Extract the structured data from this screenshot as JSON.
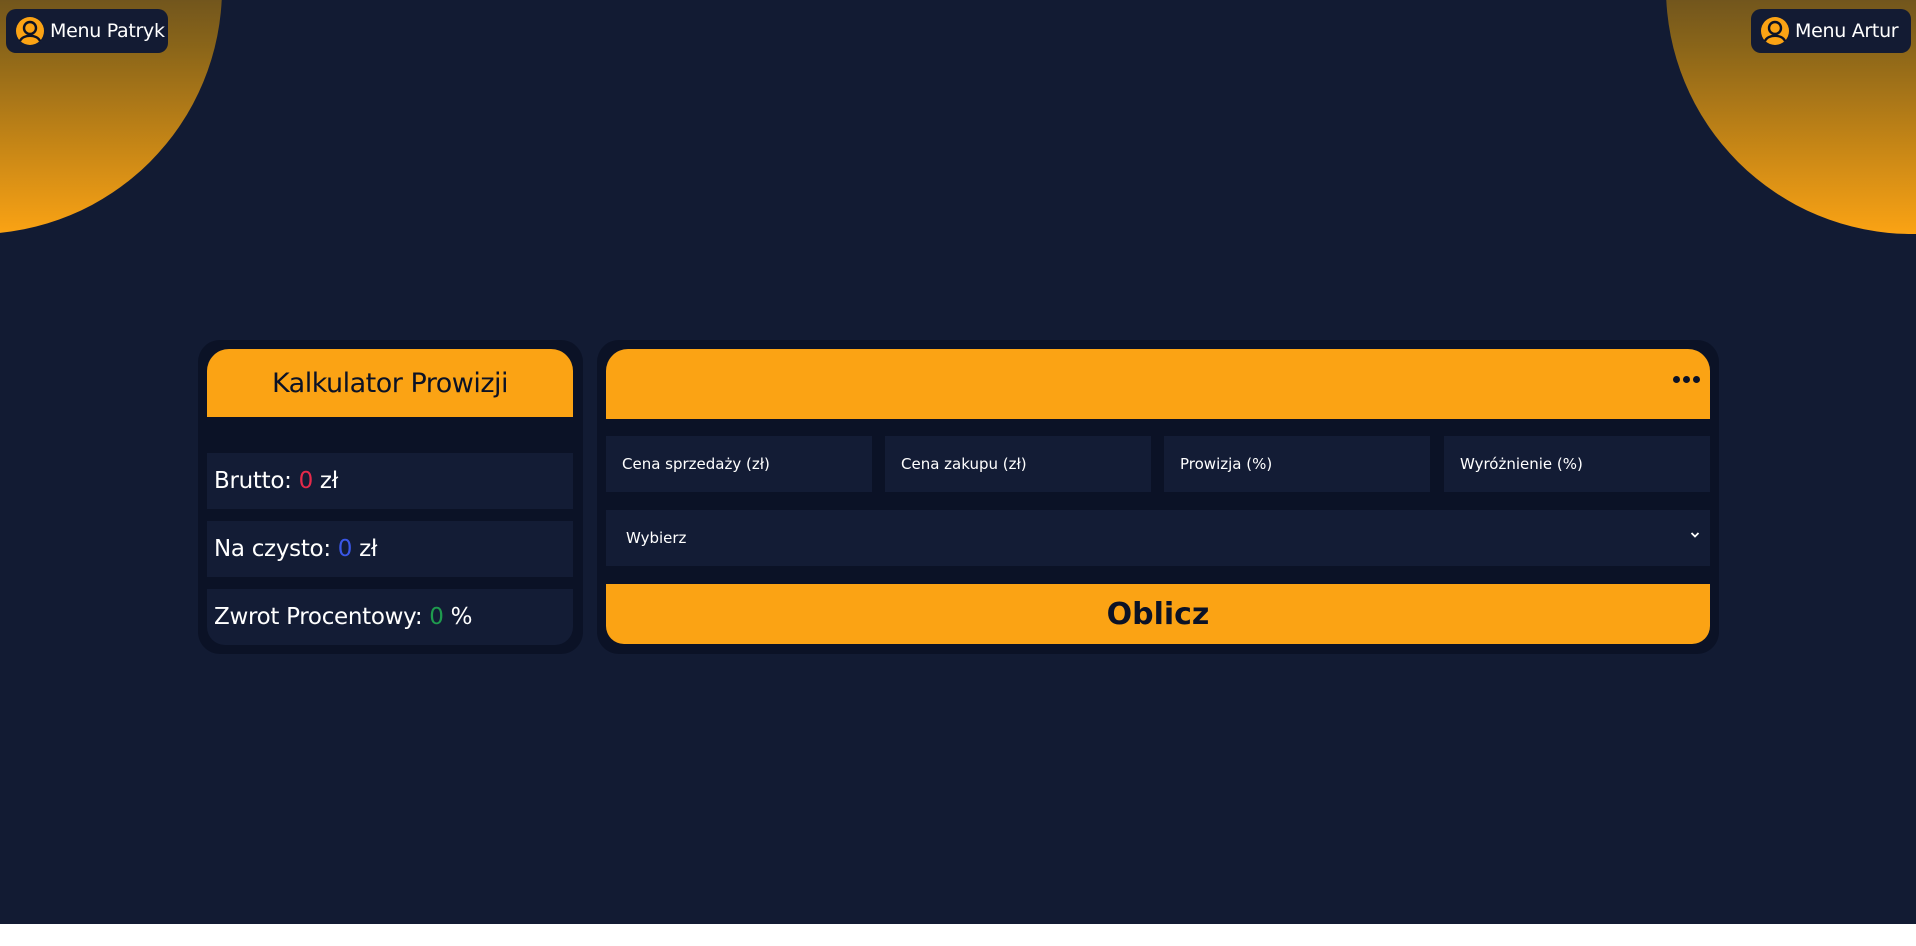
{
  "menus": {
    "left_label": "Menu Patryk",
    "right_label": "Menu Artur"
  },
  "calculator": {
    "title": "Kalkulator Prowizji",
    "stats": {
      "brutto": {
        "label": "Brutto:",
        "value": "0",
        "unit": "zł"
      },
      "net": {
        "label": "Na czysto:",
        "value": "0",
        "unit": "zł"
      },
      "return_pct": {
        "label": "Zwrot Procentowy:",
        "value": "0",
        "unit": "%"
      }
    }
  },
  "form": {
    "fields": [
      {
        "placeholder": "Cena sprzedaży (zł)"
      },
      {
        "placeholder": "Cena zakupu (zł)"
      },
      {
        "placeholder": "Prowizja (%)"
      },
      {
        "placeholder": "Wyróżnienie (%)"
      }
    ],
    "select": {
      "selected": "Wybierz"
    },
    "submit_label": "Oblicz"
  },
  "icons": {
    "menu_user": "user-circle-icon",
    "more": "more-dots-icon",
    "chevron": "chevron-down-icon"
  },
  "colors": {
    "background": "#121b33",
    "panel": "#0b1226",
    "accent": "#fba314",
    "brutto_value": "#e5294a",
    "net_value": "#3a57e8",
    "return_value": "#1f9b4e"
  }
}
